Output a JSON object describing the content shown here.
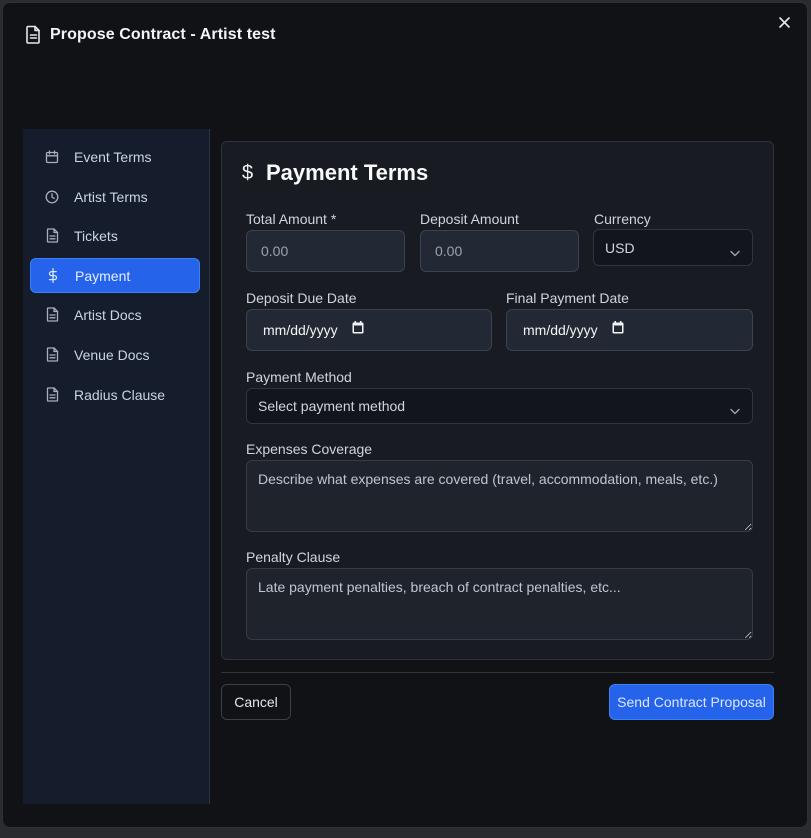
{
  "dialog": {
    "title": "Propose Contract - Artist test"
  },
  "sidebar": {
    "items": [
      {
        "label": "Event Terms",
        "icon": "calendar-icon",
        "active": false
      },
      {
        "label": "Artist Terms",
        "icon": "clock-icon",
        "active": false
      },
      {
        "label": "Tickets",
        "icon": "document-icon",
        "active": false
      },
      {
        "label": "Payment",
        "icon": "dollar-icon",
        "active": true
      },
      {
        "label": "Artist Docs",
        "icon": "document-icon",
        "active": false
      },
      {
        "label": "Venue Docs",
        "icon": "document-icon",
        "active": false
      },
      {
        "label": "Radius Clause",
        "icon": "document-icon",
        "active": false
      }
    ]
  },
  "payment": {
    "title": "Payment Terms",
    "dollar_symbol": "$",
    "total_amount": {
      "label": "Total Amount *",
      "placeholder": "0.00"
    },
    "deposit_amount": {
      "label": "Deposit Amount",
      "placeholder": "0.00"
    },
    "currency": {
      "label": "Currency",
      "value": "USD"
    },
    "deposit_due_date": {
      "label": "Deposit Due Date",
      "value": "mm/dd/yyyy"
    },
    "final_payment_date": {
      "label": "Final Payment Date",
      "value": "mm/dd/yyyy"
    },
    "payment_method": {
      "label": "Payment Method",
      "value": "Select payment method"
    },
    "expenses_coverage": {
      "label": "Expenses Coverage",
      "placeholder": "Describe what expenses are covered (travel, accommodation, meals, etc.)"
    },
    "penalty_clause": {
      "label": "Penalty Clause",
      "placeholder": "Late payment penalties, breach of contract penalties, etc..."
    }
  },
  "footer": {
    "cancel_label": "Cancel",
    "send_label": "Send Contract Proposal"
  },
  "colors": {
    "accent": "#2563eb",
    "background": "#111216",
    "sidebar": "#151c2b"
  }
}
